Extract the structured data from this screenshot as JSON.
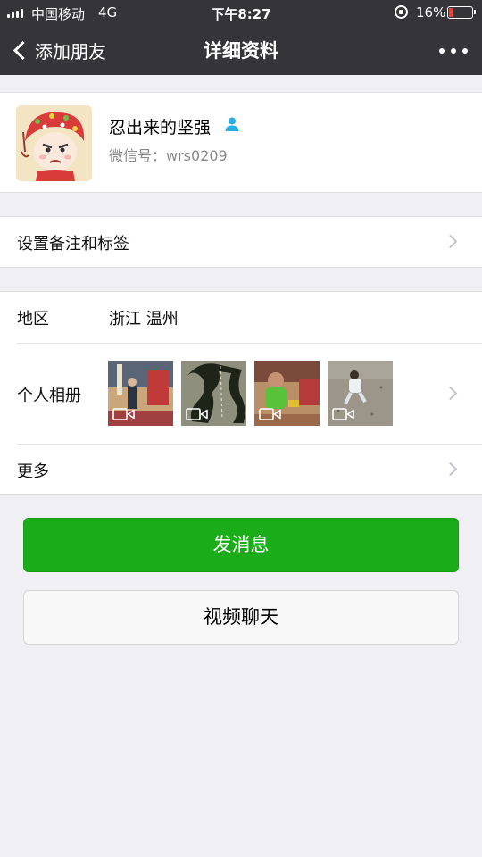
{
  "status_bar": {
    "carrier": "中国移动",
    "network": "4G",
    "time": "下午8:27",
    "battery": "16%",
    "battery_level": 0.16
  },
  "navbar": {
    "back_label": "添加朋友",
    "title": "详细资料"
  },
  "profile": {
    "nickname": "忍出来的坚强",
    "wechat_id_label": "微信号：",
    "wechat_id": "wrs0209"
  },
  "remark_row": {
    "label": "设置备注和标签"
  },
  "region_row": {
    "label": "地区",
    "value": "浙江  温州"
  },
  "album_row": {
    "label": "个人相册",
    "thumbnails": [
      {
        "type": "video",
        "icon": "video-icon"
      },
      {
        "type": "video",
        "icon": "video-icon"
      },
      {
        "type": "video",
        "icon": "video-icon"
      },
      {
        "type": "video",
        "icon": "video-icon"
      }
    ]
  },
  "more_row": {
    "label": "更多"
  },
  "buttons": {
    "send_message": "发消息",
    "video_call": "视频聊天"
  },
  "colors": {
    "header_bg": "#353539",
    "primary_green": "#1aad19",
    "page_bg": "#efeff4",
    "battery_low": "#ff3b30",
    "gender_male": "#2aaee8"
  }
}
